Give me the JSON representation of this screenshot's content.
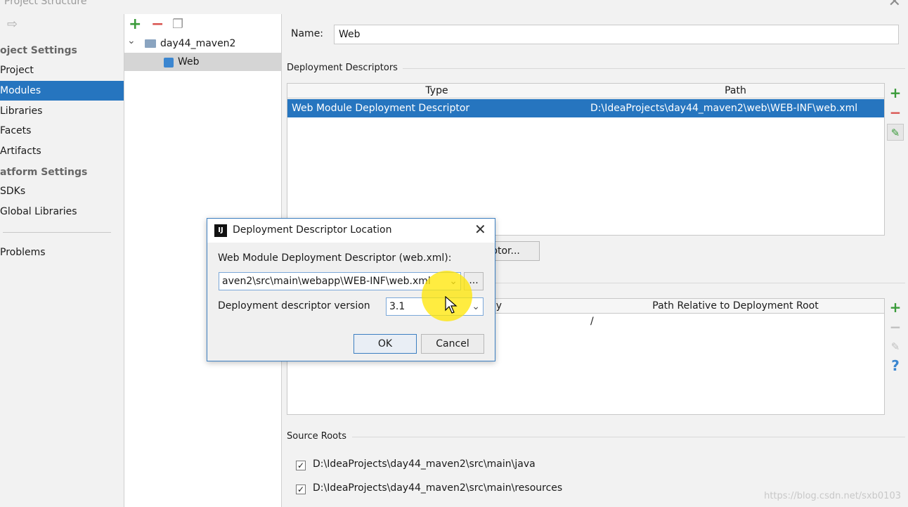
{
  "window": {
    "title": "Project Structure",
    "close_glyph": "✕"
  },
  "leftnav": {
    "back_glyph": "⇨",
    "project_settings_title": "oject Settings",
    "project_settings_items": [
      "Project",
      "Modules",
      "Libraries",
      "Facets",
      "Artifacts"
    ],
    "platform_settings_title": "atform Settings",
    "platform_settings_items": [
      "SDKs",
      "Global Libraries"
    ],
    "problems_label": "Problems",
    "selected": "Modules"
  },
  "tree": {
    "toolbar": {
      "add": "+",
      "remove": "−",
      "copy": "❐"
    },
    "nodes": [
      {
        "label": "day44_maven2",
        "expander": "⌄"
      },
      {
        "label": "Web",
        "selected": true
      }
    ]
  },
  "main": {
    "name_label": "Name:",
    "name_value": "Web",
    "deployment_descriptors_title": "Deployment Descriptors",
    "dd_table": {
      "columns": [
        "Type",
        "Path"
      ],
      "rows": [
        {
          "type": "Web Module Deployment Descriptor",
          "path": "D:\\IdeaProjects\\day44_maven2\\web\\WEB-INF\\web.xml"
        }
      ]
    },
    "add_descriptor_button_partial": "ptor...",
    "resource_table": {
      "columns_partial": "y",
      "column_path_relative": "Path Relative to Deployment Root",
      "rows": [
        {
          "path": "/"
        }
      ]
    },
    "side_buttons": {
      "add": "+",
      "remove": "−",
      "edit": "✎",
      "help": "?"
    },
    "source_roots_title": "Source Roots",
    "source_roots": [
      {
        "checked": true,
        "path": "D:\\IdeaProjects\\day44_maven2\\src\\main\\java"
      },
      {
        "checked": true,
        "path": "D:\\IdeaProjects\\day44_maven2\\src\\main\\resources"
      }
    ]
  },
  "dialog": {
    "title": "Deployment Descriptor Location",
    "logo_text": "IJ",
    "close_glyph": "✕",
    "descriptor_label": "Web Module Deployment Descriptor (web.xml):",
    "descriptor_value": "aven2\\src\\main\\webapp\\WEB-INF\\web.xml",
    "browse_label": "...",
    "version_label": "Deployment descriptor version",
    "version_value": "3.1",
    "ok_label": "OK",
    "cancel_label": "Cancel"
  },
  "watermark": "https://blog.csdn.net/sxb0103",
  "colors": {
    "accent": "#2675bf",
    "add_green": "#3a9b3a",
    "remove_red": "#d9534f",
    "highlight": "#ffe600"
  }
}
